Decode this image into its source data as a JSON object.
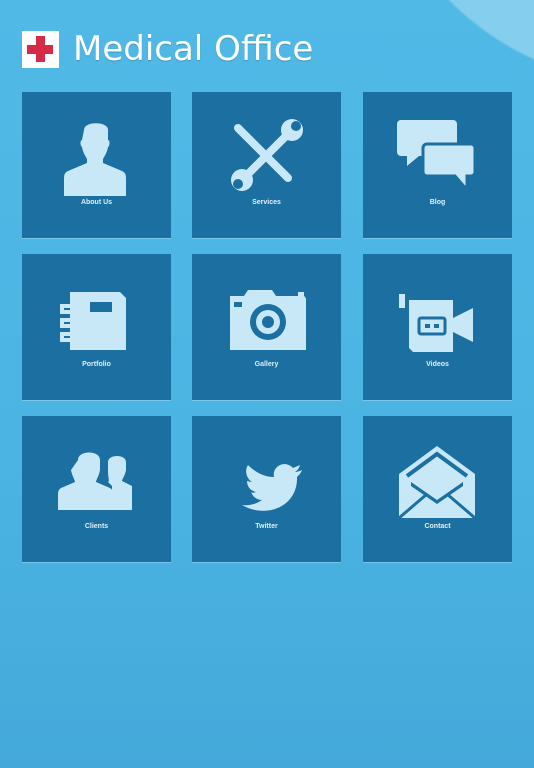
{
  "header": {
    "title": "Medical Office",
    "logo_icon": "red-cross-icon"
  },
  "tiles": [
    {
      "label": "About Us",
      "icon": "person-icon"
    },
    {
      "label": "Services",
      "icon": "tools-icon"
    },
    {
      "label": "Blog",
      "icon": "chat-bubbles-icon"
    },
    {
      "label": "Portfolio",
      "icon": "notebook-icon"
    },
    {
      "label": "Gallery",
      "icon": "camera-icon"
    },
    {
      "label": "Videos",
      "icon": "video-camera-icon"
    },
    {
      "label": "Clients",
      "icon": "people-icon"
    },
    {
      "label": "Twitter",
      "icon": "twitter-bird-icon"
    },
    {
      "label": "Contact",
      "icon": "envelope-icon"
    }
  ],
  "colors": {
    "tile": "#1b6fa1",
    "icon": "#c8e8f8",
    "cross": "#d62b47"
  }
}
